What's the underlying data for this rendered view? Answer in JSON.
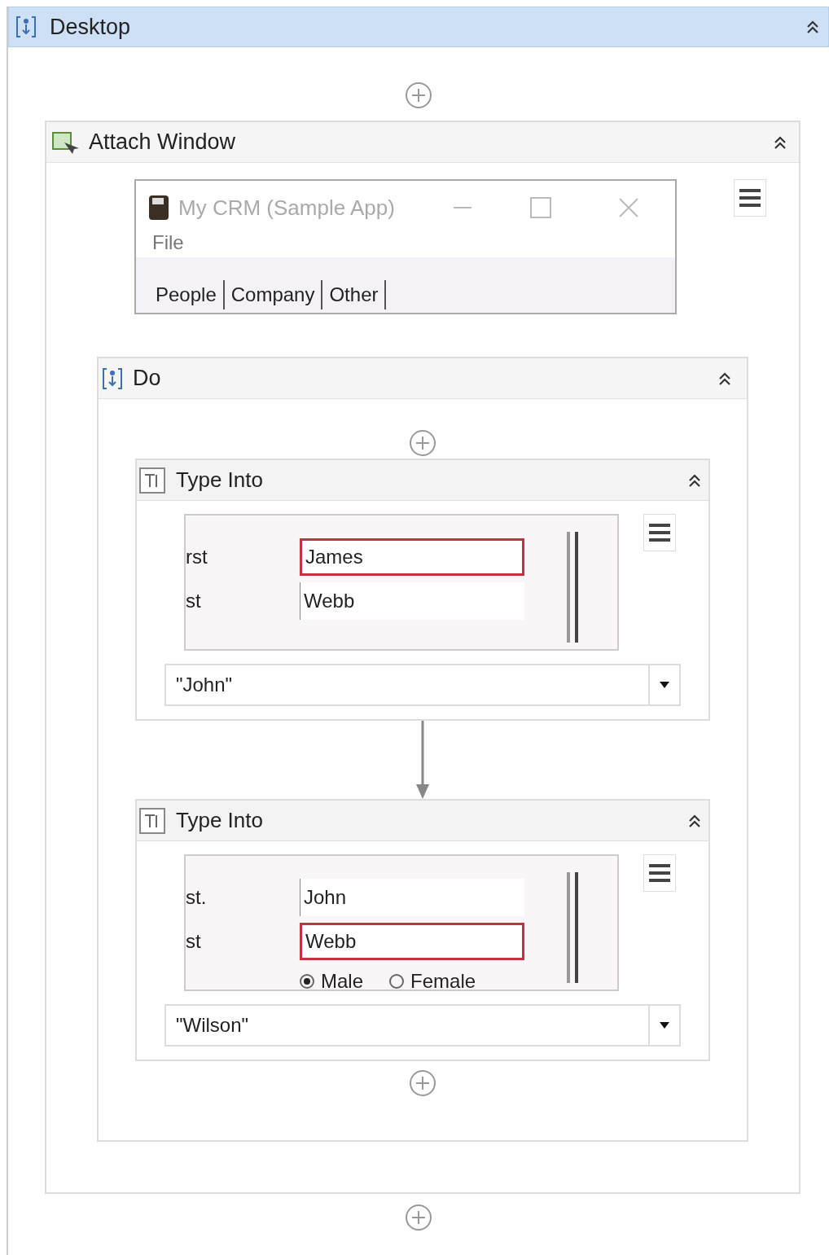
{
  "desktop": {
    "title": "Desktop"
  },
  "attach_window": {
    "title": "Attach Window",
    "window_preview": {
      "title": "My CRM (Sample App)",
      "menu": "File",
      "tabs": [
        "People",
        "Company",
        "Other"
      ]
    },
    "do": {
      "title": "Do",
      "activities": [
        {
          "kind": "type_into",
          "title": "Type Into",
          "preview": {
            "rows": [
              {
                "label": "rst",
                "value": "James",
                "highlighted": true
              },
              {
                "label": "st",
                "value": "Webb",
                "highlighted": false
              }
            ]
          },
          "text": "\"John\""
        },
        {
          "kind": "type_into",
          "title": "Type Into",
          "preview": {
            "rows": [
              {
                "label": "st.",
                "value": "John",
                "highlighted": false
              },
              {
                "label": "st",
                "value": "Webb",
                "highlighted": true
              }
            ],
            "radios": [
              {
                "label": "Male",
                "selected": true
              },
              {
                "label": "Female",
                "selected": false
              }
            ]
          },
          "text": "\"Wilson\""
        }
      ]
    }
  }
}
